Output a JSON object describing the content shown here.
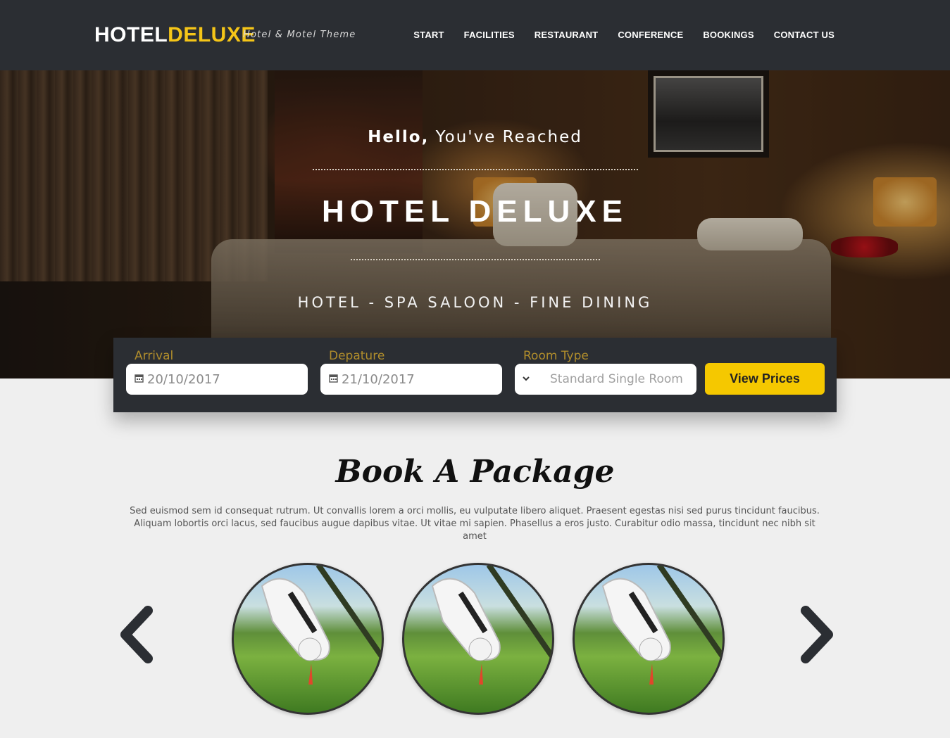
{
  "header": {
    "logo_white": "HOTEL",
    "logo_yellow": "DELUXE",
    "tagline": "Hotel & Motel Theme",
    "nav": [
      "START",
      "FACILITIES",
      "RESTAURANT",
      "CONFERENCE",
      "BOOKINGS",
      "CONTACT US"
    ]
  },
  "hero": {
    "hello_bold": "Hello,",
    "hello_rest": "You've Reached",
    "title": "HOTEL DELUXE",
    "subtitle": "HOTEL - SPA SALOON - FINE DINING"
  },
  "booking": {
    "arrival_label": "Arrival",
    "arrival_value": "20/10/2017",
    "departure_label": "Depature",
    "departure_value": "21/10/2017",
    "room_label": "Room Type",
    "room_value": "Standard Single Room",
    "button": "View Prices"
  },
  "package": {
    "title": "Book A Package",
    "text": "Sed euismod sem id consequat rutrum. Ut convallis lorem a orci mollis, eu vulputate libero aliquet. Praesent egestas nisi sed purus tincidunt faucibus. Aliquam lobortis orci lacus, sed faucibus augue dapibus vitae. Ut vitae mi sapien. Phasellus a eros justo. Curabitur odio massa, tincidunt nec nibh sit amet",
    "items": [
      "golf-image",
      "golf-image",
      "golf-image"
    ]
  },
  "colors": {
    "header_bg": "#2b2e33",
    "accent": "#f5c518",
    "button": "#f5c800"
  },
  "icons": {
    "calendar": "calendar-icon",
    "chevron": "chevron-down-icon",
    "prev": "chevron-left-icon",
    "next": "chevron-right-icon"
  }
}
